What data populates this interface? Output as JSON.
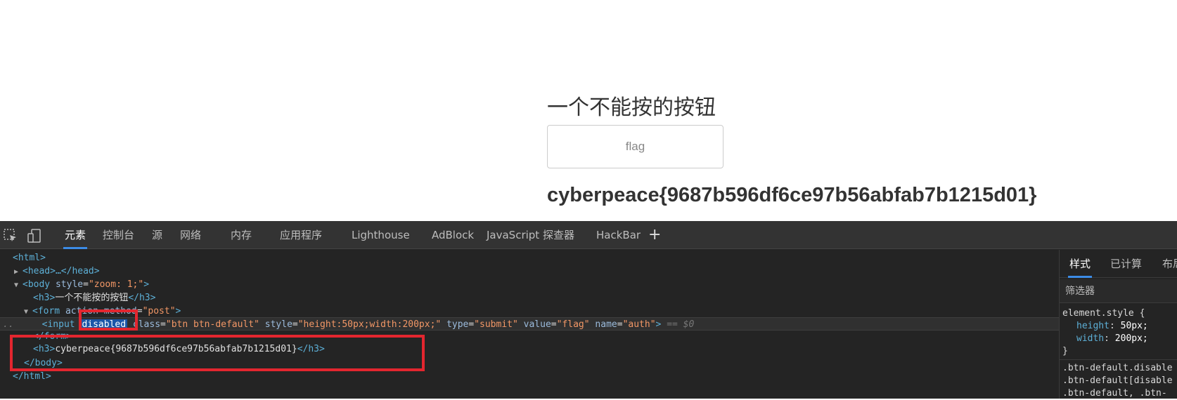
{
  "page": {
    "heading": "一个不能按的按钮",
    "button_value": "flag",
    "flag_text": "cyberpeace{9687b596df6ce97b56abfab7b1215d01}"
  },
  "devtools": {
    "tool_icons": [
      "inspect-element-icon",
      "device-toolbar-icon"
    ],
    "tabs": [
      "元素",
      "控制台",
      "源",
      "网络",
      "内存",
      "应用程序",
      "Lighthouse",
      "AdBlock",
      "JavaScript 探查器",
      "HackBar"
    ],
    "active_tab": "元素",
    "add_tab": "+",
    "dom": {
      "html_open": "<html>",
      "head": "<head>…</head>",
      "body_open_tag": "<body",
      "body_attr": "style",
      "body_attr_val": "\"zoom: 1;\"",
      "h3_open": "<h3>",
      "h3_text": "一个不能按的按钮",
      "h3_close": "</h3>",
      "form_open_tag": "<form",
      "form_attr_action": "action",
      "form_attr_method": "method",
      "form_method_val": "\"post\"",
      "input_open_tag": "<input",
      "input_attr_disabled": "disabled",
      "input_attr_class": "class",
      "input_class_val": "\"btn btn-default\"",
      "input_attr_style": "style",
      "input_style_val": "\"height:50px;width:200px;\"",
      "input_attr_type": "type",
      "input_type_val": "\"submit\"",
      "input_attr_value": "value",
      "input_value_val": "\"flag\"",
      "input_attr_name": "name",
      "input_name_val": "\"auth\"",
      "input_end": ">",
      "selected_marker": "== $0",
      "gutter_dots": "..",
      "form_close": "</form>",
      "h3_flag_text": "cyberpeace{9687b596df6ce97b56abfab7b1215d01}",
      "body_close": "</body>",
      "html_close": "</html>"
    },
    "styles": {
      "tabs": [
        "样式",
        "已计算",
        "布局"
      ],
      "active_tab": "样式",
      "filter_placeholder": "筛选器",
      "element_style_selector": "element.style {",
      "rules": [
        {
          "prop": "height",
          "value": "50px;"
        },
        {
          "prop": "width",
          "value": "200px;"
        }
      ],
      "close_brace": "}",
      "more_selectors": [
        ".btn-default.disable",
        ".btn-default[disable",
        ".btn-default, .btn-"
      ]
    }
  }
}
